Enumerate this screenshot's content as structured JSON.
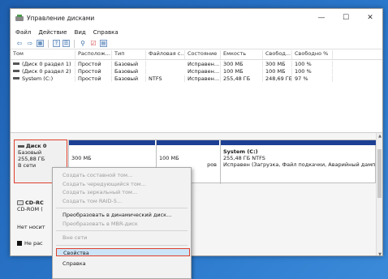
{
  "window": {
    "title": "Управление дисками",
    "controls": {
      "minimize": "—",
      "maximize": "☐",
      "close": "✕"
    }
  },
  "menu": [
    "Файл",
    "Действие",
    "Вид",
    "Справка"
  ],
  "toolbar_icons": [
    "back-arrow-icon",
    "forward-arrow-icon",
    "grid-icon",
    "help-icon",
    "list-icon",
    "connect-icon",
    "check-icon",
    "properties-icon"
  ],
  "volumes": {
    "headers": [
      "Том",
      "Располож...",
      "Тип",
      "Файловая с...",
      "Состояние",
      "Емкость",
      "Свобод...",
      "Свободно %"
    ],
    "rows": [
      [
        "(Диск 0 раздел 1)",
        "Простой",
        "Базовый",
        "",
        "Исправен...",
        "300 МБ",
        "300 МБ",
        "100 %"
      ],
      [
        "(Диск 0 раздел 2)",
        "Простой",
        "Базовый",
        "",
        "Исправен...",
        "100 МБ",
        "100 МБ",
        "100 %"
      ],
      [
        "System (C:)",
        "Простой",
        "Базовый",
        "NTFS",
        "Исправен...",
        "255,48 ГБ",
        "248,69 ГБ",
        "97 %"
      ]
    ]
  },
  "disk0": {
    "name": "Диск 0",
    "type": "Базовый",
    "size": "255,88 ГБ",
    "status": "В сети",
    "partitions": [
      {
        "size": "300 МБ",
        "status": ""
      },
      {
        "size": "100 МБ",
        "status": "ров"
      },
      {
        "name": "System  (C:)",
        "size": "255,48 ГБ NTFS",
        "status": "Исправен (Загрузка, Файл подкачки, Аварийный дамп пам"
      }
    ]
  },
  "cdrom": {
    "name": "CD-RC",
    "type": "CD-ROM (",
    "no_media": "Нет носит"
  },
  "legend": {
    "label": "Не рас"
  },
  "context_menu": {
    "items": [
      {
        "label": "Создать составной том...",
        "disabled": true
      },
      {
        "label": "Создать чередующийся том...",
        "disabled": true
      },
      {
        "label": "Создать зеркальный том...",
        "disabled": true
      },
      {
        "label": "Создать том RAID-5...",
        "disabled": true
      },
      {
        "label": "Преобразовать в динамический диск...",
        "disabled": false
      },
      {
        "label": "Преобразовать в MBR-диск",
        "disabled": true
      },
      {
        "label": "Вне сети",
        "disabled": true
      },
      {
        "label": "Свойства",
        "disabled": false,
        "selected": true
      },
      {
        "label": "Справка",
        "disabled": false
      }
    ]
  },
  "colors": {
    "partition_header": "#1c3f94",
    "highlight": "#e0402b",
    "selection": "#cce4f7"
  }
}
